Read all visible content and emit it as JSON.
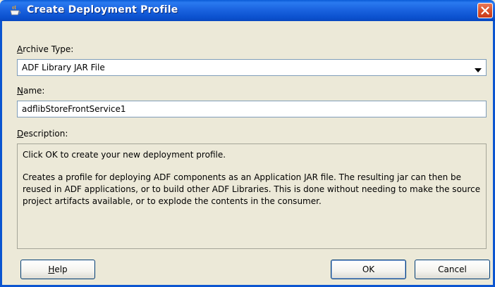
{
  "window": {
    "title": "Create Deployment Profile"
  },
  "form": {
    "archive_type_label_accel": "A",
    "archive_type_label_rest": "rchive Type:",
    "archive_type_value": "ADF Library JAR File",
    "name_label_accel": "N",
    "name_label_rest": "ame:",
    "name_value": "adflibStoreFrontService1",
    "description_label_accel": "D",
    "description_label_rest": "escription:",
    "description_line1": "Click OK to create your new deployment profile.",
    "description_line2": "Creates a profile for deploying ADF components as an Application JAR file. The resulting jar can then be reused in ADF applications, or to build other ADF Libraries. This is done without needing to make the source project artifacts available, or to explode the contents in the consumer."
  },
  "buttons": {
    "help_accel": "H",
    "help_rest": "elp",
    "ok": "OK",
    "cancel": "Cancel"
  },
  "icons": {
    "app": "coffee-cup-icon",
    "close": "close-icon",
    "dropdown": "chevron-down-icon"
  },
  "colors": {
    "titlebar": "#0b55d0",
    "dialog_bg": "#ece9d8",
    "close_button": "#d9512a"
  }
}
